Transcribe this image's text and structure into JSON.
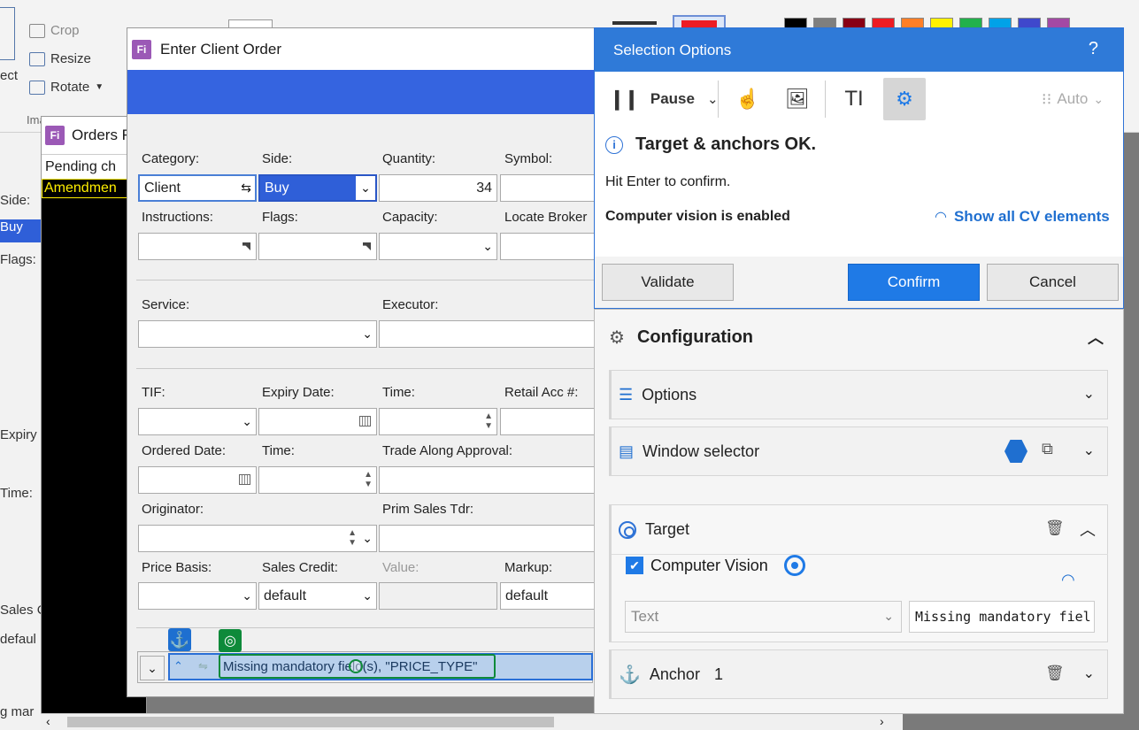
{
  "background_app": {
    "ribbon": {
      "crop": "Crop",
      "resize": "Resize",
      "rotate": "Rotate",
      "select_partial": "ect",
      "image_partial": "Ima"
    },
    "left_labels": {
      "side": "Side:",
      "buy": "Buy",
      "flags": "Flags:",
      "expiry": "Expiry",
      "time": "Time:",
      "sales": "Sales C",
      "default": "defaul",
      "missing": "g mar"
    },
    "swatch_colors": [
      "#000000",
      "#7f7f7f",
      "#880015",
      "#ed1c24",
      "#ff7f27",
      "#fff200",
      "#22b14c",
      "#00a2e8",
      "#3f48cc",
      "#a349a4"
    ]
  },
  "orders_window": {
    "title": "Orders F",
    "pending": "Pending ch",
    "amendment": "Amendmen",
    "logo": "Fi"
  },
  "order_form": {
    "title": "Enter Client Order",
    "logo": "Fi",
    "labels": {
      "category": "Category:",
      "side": "Side:",
      "quantity": "Quantity:",
      "symbol": "Symbol:",
      "instructions": "Instructions:",
      "flags": "Flags:",
      "capacity": "Capacity:",
      "locate_broker": "Locate Broker",
      "service": "Service:",
      "executor": "Executor:",
      "tif": "TIF:",
      "expiry_date": "Expiry Date:",
      "time": "Time:",
      "retail_acc": "Retail Acc #:",
      "ordered_date": "Ordered Date:",
      "time2": "Time:",
      "trade_along": "Trade Along Approval:",
      "originator": "Originator:",
      "prim_sales": "Prim Sales Tdr:",
      "price_basis": "Price Basis:",
      "sales_credit": "Sales Credit:",
      "value": "Value:",
      "markup": "Markup:"
    },
    "values": {
      "category": "Client",
      "side": "Buy",
      "quantity": "34",
      "sales_credit": "default",
      "markup": "default"
    },
    "status_message": "Missing mandatory field(s), \"PRICE_TYPE\""
  },
  "selection_options": {
    "title": "Selection Options",
    "help": "?",
    "pause_label": "Pause",
    "auto_label": "Auto",
    "status_title": "Target & anchors OK.",
    "hint": "Hit Enter to confirm.",
    "cv_enabled": "Computer vision is enabled",
    "show_cv": "Show all CV elements",
    "validate": "Validate",
    "confirm": "Confirm",
    "cancel": "Cancel"
  },
  "configuration": {
    "title": "Configuration",
    "options": "Options",
    "window_selector": "Window selector",
    "target": "Target",
    "computer_vision": "Computer Vision",
    "text_type": "Text",
    "text_value": "Missing mandatory fiel",
    "anchor": "Anchor",
    "anchor_count": "1"
  }
}
